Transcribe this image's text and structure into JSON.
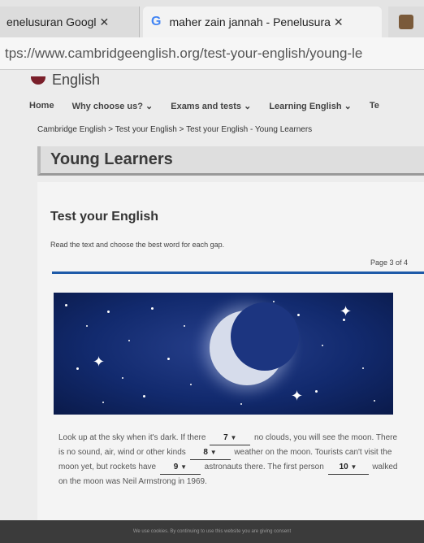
{
  "browser": {
    "tabs": [
      {
        "title": "enelusuran Googl",
        "close": "✕"
      },
      {
        "icon": "G",
        "title": "maher zain jannah - Penelusura",
        "close": "✕"
      }
    ],
    "url": "tps://www.cambridgeenglish.org/test-your-english/young-le"
  },
  "site": {
    "logo_text": "English",
    "nav": [
      "Home",
      "Why choose us? ⌄",
      "Exams and tests ⌄",
      "Learning English ⌄",
      "Te"
    ],
    "breadcrumb": "Cambridge English > Test your English > Test your English - Young Learners",
    "page_title": "Young Learners"
  },
  "test": {
    "heading": "Test your English",
    "instruction": "Read the text and choose the best word for each gap.",
    "page_indicator": "Page 3 of 4",
    "passage": {
      "p1": "Look up at the sky when it's dark. If there",
      "gap7": "7",
      "p2": "no clouds, you will see the moon. There is no sound, air, wind or other kinds",
      "gap8": "8",
      "p3": "weather on the moon. Tourists can't visit the moon yet, but rockets have",
      "gap9": "9",
      "p4": "astronauts there. The first person",
      "gap10": "10",
      "p5": "walked on the moon was Neil Armstrong in 1969."
    }
  },
  "footer": {
    "cookie_text": "We use cookies. By continuing to use this website you are giving consent"
  }
}
